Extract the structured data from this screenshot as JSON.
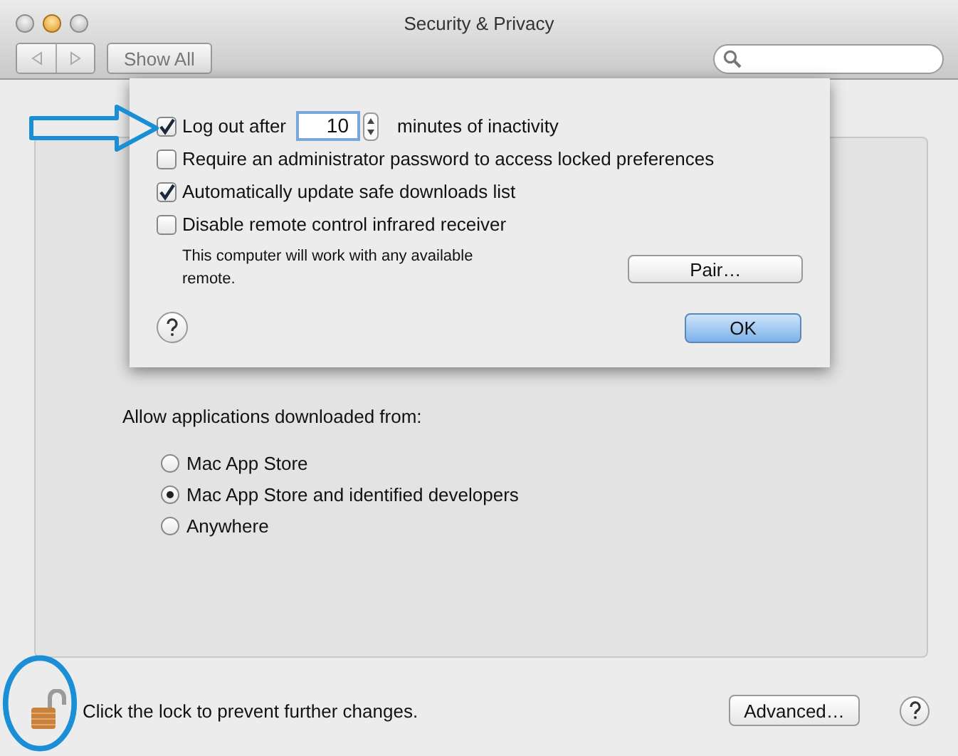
{
  "window": {
    "title": "Security & Privacy"
  },
  "toolbar": {
    "show_all": "Show All"
  },
  "gatekeeper": {
    "heading": "Allow applications downloaded from:",
    "options": [
      {
        "label": "Mac App Store",
        "selected": false
      },
      {
        "label": "Mac App Store and identified developers",
        "selected": true
      },
      {
        "label": "Anywhere",
        "selected": false
      }
    ]
  },
  "footer": {
    "lock_text": "Click the lock to prevent further changes.",
    "advanced_button": "Advanced…"
  },
  "sheet": {
    "options": [
      {
        "kind": "timeout",
        "checked": true,
        "label": "Log out after",
        "value": "10",
        "suffix": "minutes of inactivity"
      },
      {
        "kind": "checkbox",
        "checked": false,
        "label": "Require an administrator password to access locked preferences"
      },
      {
        "kind": "checkbox",
        "checked": true,
        "label": "Automatically update safe downloads list"
      },
      {
        "kind": "checkbox",
        "checked": false,
        "label": "Disable remote control infrared receiver"
      }
    ],
    "note": "This computer will work with any available remote.",
    "pair_button": "Pair…",
    "ok_button": "OK"
  }
}
